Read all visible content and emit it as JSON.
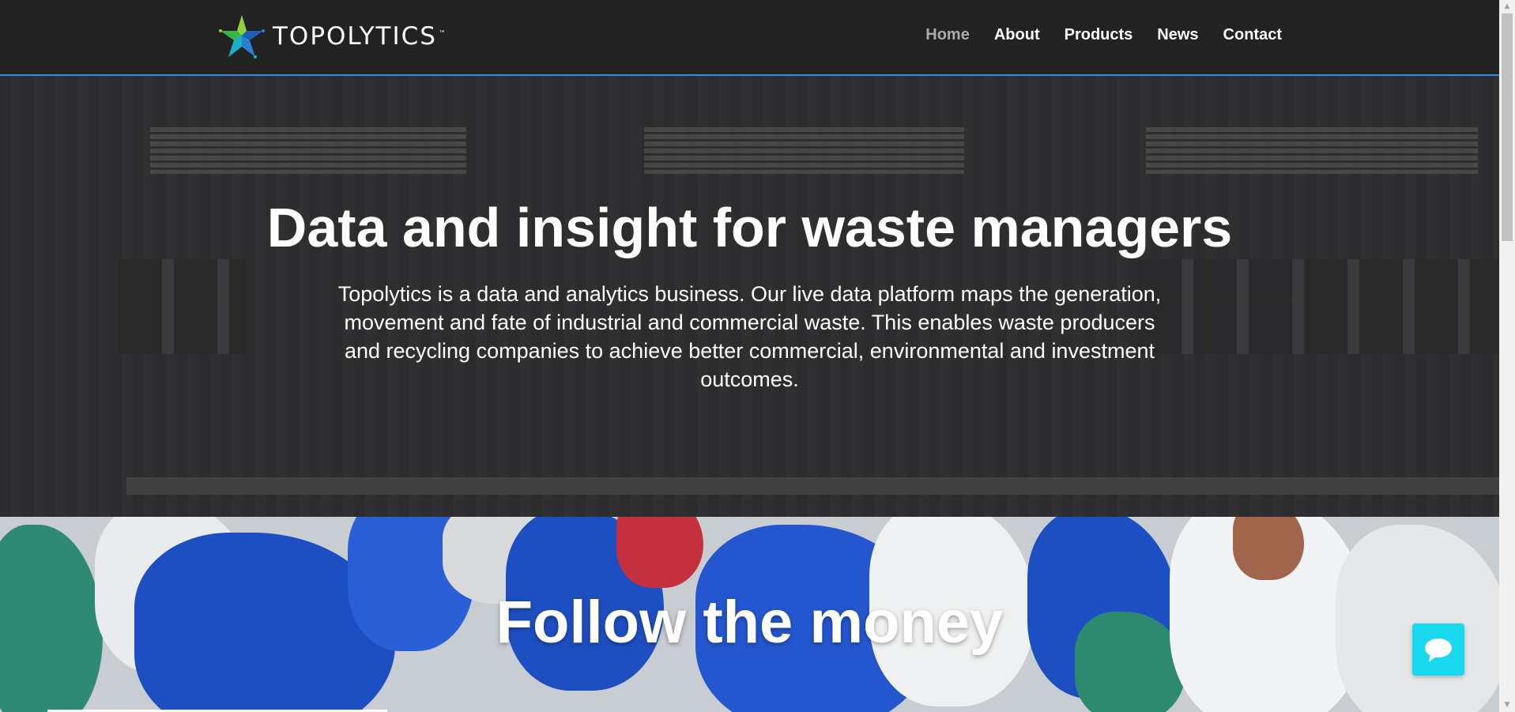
{
  "header": {
    "logo_text": "TOPOLYTICS",
    "logo_tm": "™",
    "logo_icon": "star-logo-icon"
  },
  "nav": {
    "items": [
      {
        "label": "Home",
        "active": true
      },
      {
        "label": "About",
        "active": false
      },
      {
        "label": "Products",
        "active": false
      },
      {
        "label": "News",
        "active": false
      },
      {
        "label": "Contact",
        "active": false
      }
    ]
  },
  "hero": {
    "title": "Data and insight for waste managers",
    "text": "Topolytics is a data and analytics business.  Our live data platform maps the generation, movement and fate of industrial and commercial waste.  This enables waste producers and recycling companies to achieve better commercial, environmental and investment outcomes."
  },
  "section2": {
    "title": "Follow the money"
  },
  "chat": {
    "icon": "chat-bubble-icon"
  },
  "colors": {
    "header_bg": "#222222",
    "accent_border": "#2e8be6",
    "nav_active": "#aaaaaa",
    "chat_button": "#18d8f0"
  }
}
